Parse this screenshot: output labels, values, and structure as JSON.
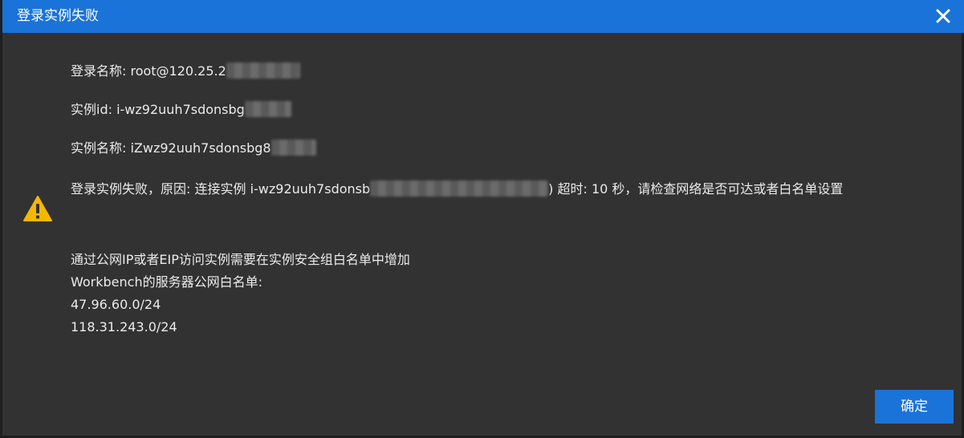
{
  "dialog": {
    "title": "登录实例失败",
    "close_icon": "close-icon",
    "warning_icon": "warning-triangle-icon",
    "accent_color": "#1a73d9",
    "warning_color": "#f5b800"
  },
  "details": {
    "login_name": "登录名称: root@120.25.2",
    "instance_id": "实例id: i-wz92uuh7sdonsbg",
    "instance_name": "实例名称: iZwz92uuh7sdonsbg8",
    "error_prefix": "登录实例失败，原因: 连接实例 i-wz92uuh7sdonsb",
    "error_suffix": ") 超时: 10 秒，请检查网络是否可达或者白名单设置",
    "hint_line1": "通过公网IP或者EIP访问实例需要在实例安全组白名单中增加",
    "hint_line2": "Workbench的服务器公网白名单:",
    "ip_1": "47.96.60.0/24",
    "ip_2": "118.31.243.0/24"
  },
  "buttons": {
    "confirm_label": "确定"
  }
}
